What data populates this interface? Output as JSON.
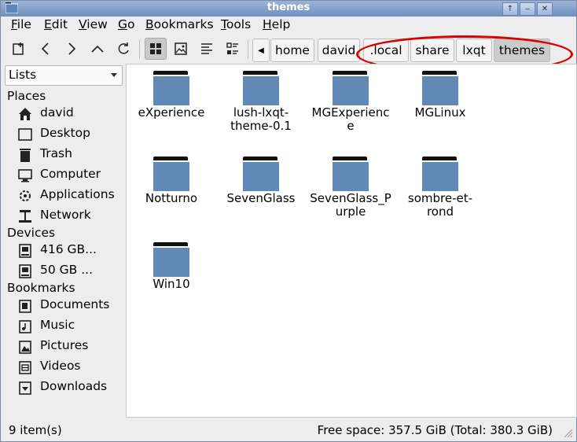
{
  "window": {
    "title": "themes"
  },
  "titlebar_buttons": [
    {
      "name": "up-arrow-button",
      "glyph": "↑"
    },
    {
      "name": "minimize-button",
      "glyph": "‒"
    },
    {
      "name": "close-button",
      "glyph": "✕"
    }
  ],
  "menubar": [
    {
      "label": "File",
      "key": "F",
      "rest": "ile"
    },
    {
      "label": "Edit",
      "key": "E",
      "rest": "dit"
    },
    {
      "label": "View",
      "key": "V",
      "rest": "iew"
    },
    {
      "label": "Go",
      "key": "G",
      "rest": "o"
    },
    {
      "label": "Bookmarks",
      "key": "B",
      "rest": "ookmarks"
    },
    {
      "label": "Tools",
      "key": "T",
      "rest": "ools"
    },
    {
      "label": "Help",
      "key": "H",
      "rest": "elp"
    }
  ],
  "toolbar": {
    "icons": [
      "new-window-icon",
      "back-icon",
      "forward-icon",
      "up-icon",
      "reload-icon",
      "icon-view-icon",
      "thumbnail-view-icon",
      "compact-view-icon",
      "detailed-view-icon"
    ],
    "active_view": "icon-view"
  },
  "breadcrumb": [
    "home",
    "david",
    ".local",
    "share",
    "lxqt",
    "themes"
  ],
  "sidebar": {
    "mode": "Lists",
    "places_label": "Places",
    "places": [
      {
        "label": "david",
        "icon": "home-icon"
      },
      {
        "label": "Desktop",
        "icon": "desktop-icon"
      },
      {
        "label": "Trash",
        "icon": "trash-icon"
      },
      {
        "label": "Computer",
        "icon": "computer-icon"
      },
      {
        "label": "Applications",
        "icon": "applications-icon"
      },
      {
        "label": "Network",
        "icon": "network-icon"
      }
    ],
    "devices_label": "Devices",
    "devices": [
      {
        "label": "416 GB...",
        "icon": "drive-icon"
      },
      {
        "label": "50 GB ...",
        "icon": "drive-icon"
      }
    ],
    "bookmarks_label": "Bookmarks",
    "bookmarks": [
      {
        "label": "Documents",
        "icon": "documents-icon"
      },
      {
        "label": "Music",
        "icon": "music-icon"
      },
      {
        "label": "Pictures",
        "icon": "pictures-icon"
      },
      {
        "label": "Videos",
        "icon": "videos-icon"
      },
      {
        "label": "Downloads",
        "icon": "downloads-icon"
      }
    ]
  },
  "files": [
    {
      "name": "eXperience",
      "selected": true
    },
    {
      "name": "lush-lxqt-theme-0.1"
    },
    {
      "name": "MGExperience"
    },
    {
      "name": "MGLinux"
    },
    {
      "name": "Notturno"
    },
    {
      "name": "SevenGlass"
    },
    {
      "name": "SevenGlass_Purple"
    },
    {
      "name": "sombre-et-rond"
    },
    {
      "name": "Win10"
    }
  ],
  "status": {
    "items": "9 item(s)",
    "free_space": "Free space: 357.5 GiB (Total: 380.3 GiB)"
  },
  "colors": {
    "folder": "#6189b7",
    "highlight_ring": "#d80000",
    "titlebar": "#7f9ccb"
  }
}
